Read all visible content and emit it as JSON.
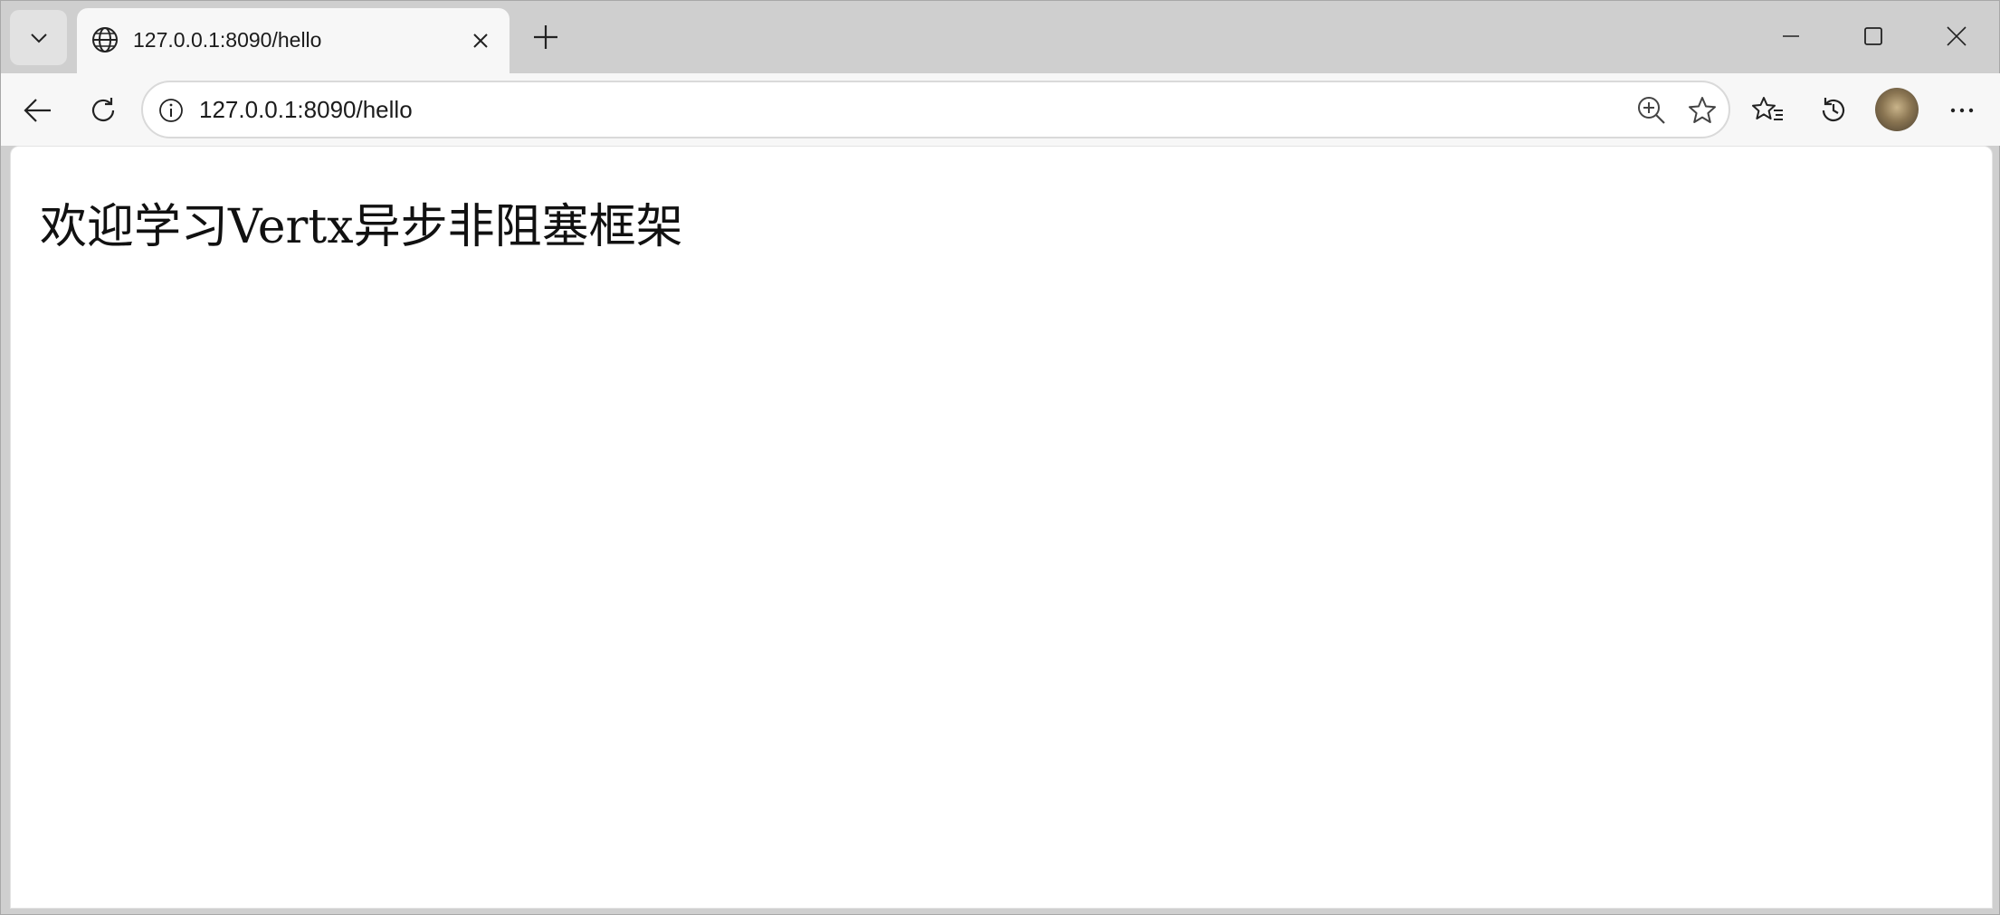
{
  "tab": {
    "title": "127.0.0.1:8090/hello"
  },
  "addressbar": {
    "url": "127.0.0.1:8090/hello"
  },
  "page": {
    "heading": "欢迎学习Vertx异步非阻塞框架"
  },
  "icons": {
    "tab_menu": "chevron-down-icon",
    "favicon": "globe-icon",
    "tab_close": "close-icon",
    "new_tab": "plus-icon",
    "minimize": "minimize-icon",
    "maximize": "maximize-icon",
    "window_close": "close-icon",
    "back": "arrow-left-icon",
    "reload": "reload-icon",
    "site_info": "info-icon",
    "zoom": "zoom-in-icon",
    "favorite": "star-icon",
    "favorites": "favorites-icon",
    "history": "history-icon",
    "more": "more-icon"
  },
  "colors": {
    "frame": "#cfcfcf",
    "toolbar": "#f7f7f7",
    "page_background": "#ffffff",
    "text": "#1b1b1b"
  }
}
